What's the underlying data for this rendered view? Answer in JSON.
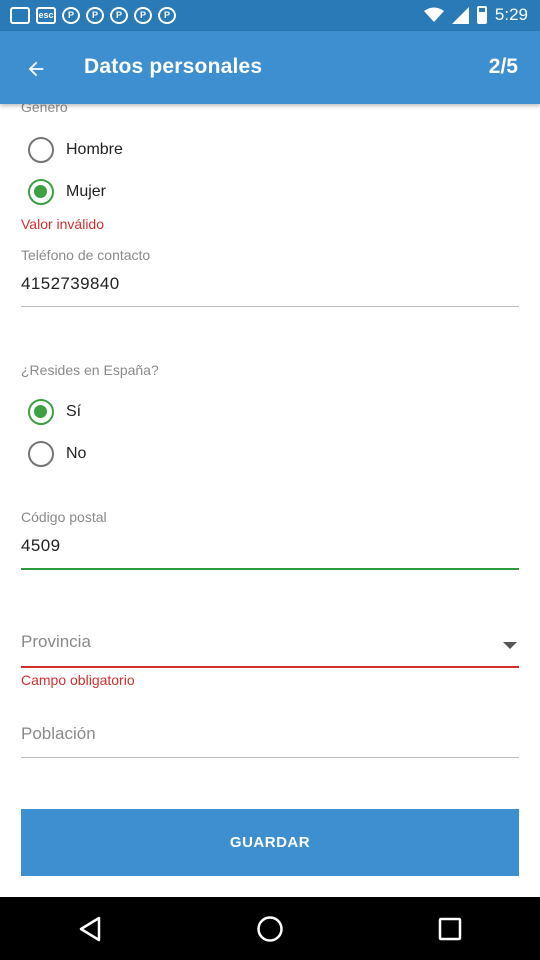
{
  "status_bar": {
    "time": "5:29",
    "notification_icons": [
      "nfc-icon",
      "esc-icon",
      "pinterest-icon",
      "pinterest-icon",
      "pinterest-icon",
      "pinterest-icon",
      "pinterest-icon"
    ],
    "esc_text": "esc"
  },
  "app_bar": {
    "title": "Datos personales",
    "step": "2/5"
  },
  "gender": {
    "label": "Género",
    "options": [
      {
        "label": "Hombre",
        "checked": false
      },
      {
        "label": "Mujer",
        "checked": true
      }
    ],
    "error": "Valor inválido"
  },
  "phone": {
    "label": "Teléfono de contacto",
    "value": "4152739840"
  },
  "residence": {
    "label": "¿Resides en España?",
    "options": [
      {
        "label": "Sí",
        "checked": true
      },
      {
        "label": "No",
        "checked": false
      }
    ]
  },
  "postal_code": {
    "label": "Código postal",
    "value": "4509"
  },
  "province": {
    "placeholder": "Provincia",
    "error": "Campo obligatorio"
  },
  "city": {
    "placeholder": "Población"
  },
  "save_label": "GUARDAR",
  "colors": {
    "primary": "#3d8fd0",
    "status_bar": "#2a7ab8",
    "accent_green": "#3da043",
    "error_red": "#d32f2f"
  }
}
